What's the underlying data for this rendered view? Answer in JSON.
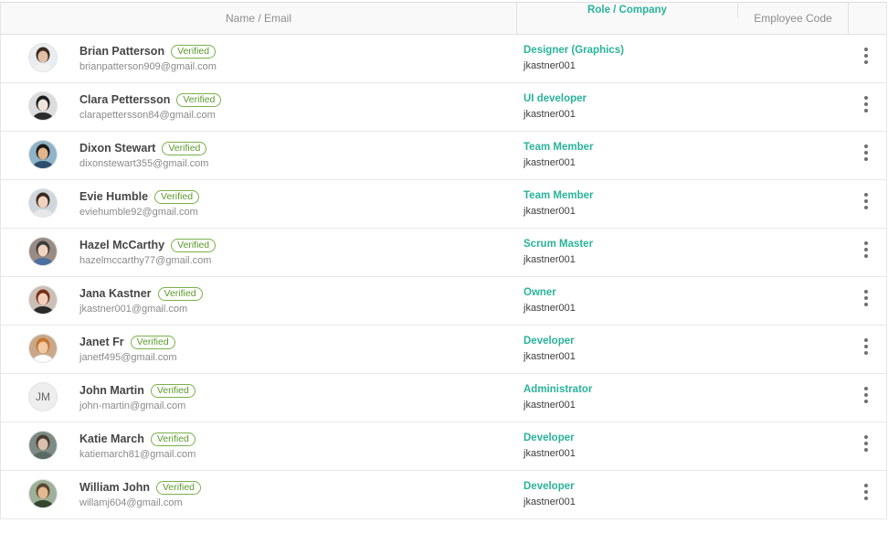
{
  "header": {
    "name_email": "Name / Email",
    "role_company": "Role / Company",
    "employee_code": "Employee Code"
  },
  "verified_label": "Verified",
  "accent_color": "#2ab39a",
  "verified_color": "#5c9a2c",
  "users": [
    {
      "name": "Brian Patterson",
      "email": "brianpatterson909@gmail.com",
      "role": "Designer (Graphics)",
      "company": "jkastner001",
      "avatar": "photo"
    },
    {
      "name": "Clara Pettersson",
      "email": "clarapettersson84@gmail.com",
      "role": "UI developer",
      "company": "jkastner001",
      "avatar": "photo"
    },
    {
      "name": "Dixon Stewart",
      "email": "dixonstewart355@gmail.com",
      "role": "Team Member",
      "company": "jkastner001",
      "avatar": "photo"
    },
    {
      "name": "Evie Humble",
      "email": "eviehumble92@gmail.com",
      "role": "Team Member",
      "company": "jkastner001",
      "avatar": "photo"
    },
    {
      "name": "Hazel McCarthy",
      "email": "hazelmccarthy77@gmail.com",
      "role": "Scrum Master",
      "company": "jkastner001",
      "avatar": "photo"
    },
    {
      "name": "Jana Kastner",
      "email": "jkastner001@gmail.com",
      "role": "Owner",
      "company": "jkastner001",
      "avatar": "photo"
    },
    {
      "name": "Janet Fr",
      "email": "janetf495@gmail.com",
      "role": "Developer",
      "company": "jkastner001",
      "avatar": "photo"
    },
    {
      "name": "John Martin",
      "email": "john-martin@gmail.com",
      "role": "Administrator",
      "company": "jkastner001",
      "avatar": "JM"
    },
    {
      "name": "Katie March",
      "email": "katiemarch81@gmail.com",
      "role": "Developer",
      "company": "jkastner001",
      "avatar": "photo"
    },
    {
      "name": "William John",
      "email": "willamj604@gmail.com",
      "role": "Developer",
      "company": "jkastner001",
      "avatar": "photo"
    }
  ]
}
